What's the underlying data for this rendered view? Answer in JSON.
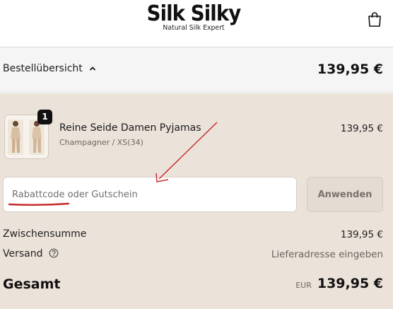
{
  "header": {
    "brand": "Silk Silky",
    "tagline": "Natural Silk Expert",
    "cart_icon": "shopping-bag-icon"
  },
  "summary": {
    "toggle_label": "Bestellübersicht",
    "toggle_icon": "chevron-up-icon",
    "total": "139,95 €"
  },
  "line_item": {
    "quantity": "1",
    "title": "Reine Seide Damen Pyjamas",
    "variant": "Champagner / XS(34)",
    "price": "139,95 €"
  },
  "discount": {
    "placeholder": "Rabattcode oder Gutschein",
    "apply_label": "Anwenden"
  },
  "costs": {
    "subtotal_label": "Zwischensumme",
    "subtotal_value": "139,95 €",
    "shipping_label": "Versand",
    "shipping_value": "Lieferadresse eingeben",
    "help_icon": "question-circle-icon",
    "total_label": "Gesamt",
    "currency": "EUR",
    "total_value": "139,95 €"
  },
  "annotation": {
    "color": "#c62828"
  },
  "colors": {
    "panel_bg": "#ebe2d9",
    "summary_bg": "#f5f5f5"
  }
}
